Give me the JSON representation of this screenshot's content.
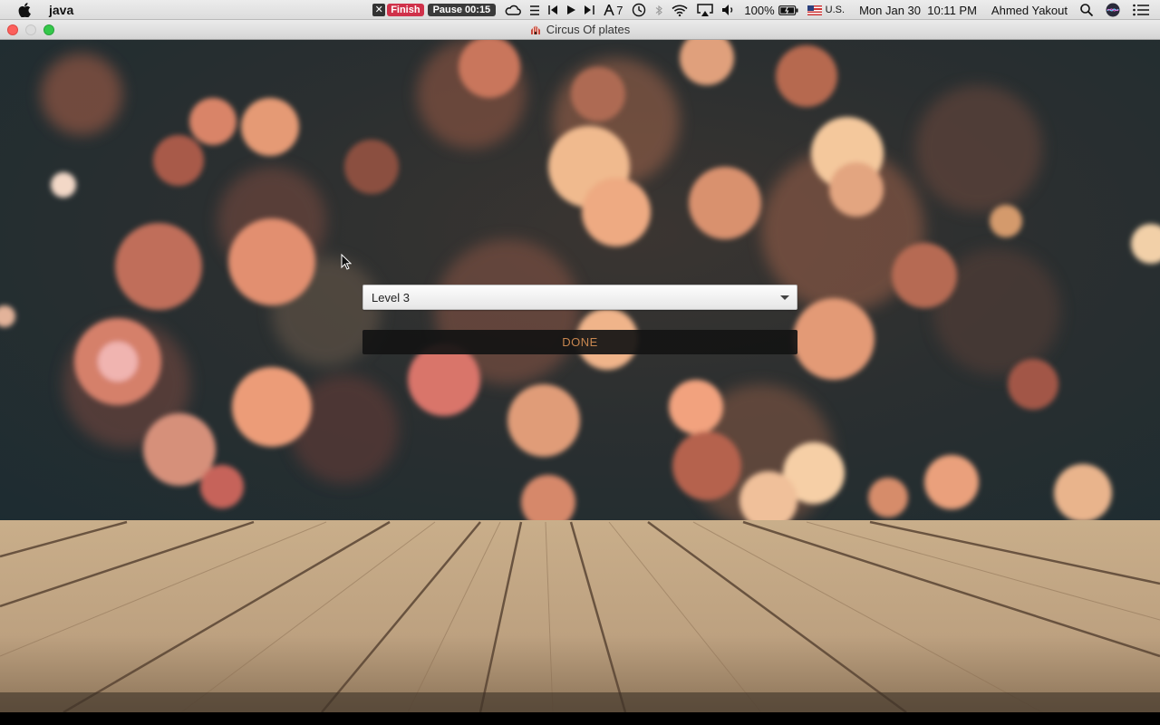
{
  "menubar": {
    "app_name": "java",
    "finish_label": "Finish",
    "pause_label": "Pause 00:15",
    "tab_count": "7",
    "battery": "100%",
    "input_source": "U.S.",
    "datetime": "Mon Jan 30  10:11 PM",
    "user": "Ahmed Yakout"
  },
  "window": {
    "title": "Circus Of plates"
  },
  "game": {
    "level_selected": "Level 3",
    "done_label": "DONE"
  },
  "colors": {
    "done_text": "#c7864f",
    "close": "#fc605c",
    "maximize": "#34c84a"
  },
  "icons": [
    "apple-icon",
    "cloud-icon",
    "list-icon",
    "prev-track-icon",
    "play-icon",
    "next-track-icon",
    "translate-icon",
    "time-machine-icon",
    "bluetooth-icon",
    "wifi-icon",
    "airplay-icon",
    "volume-icon",
    "battery-icon",
    "flag-icon",
    "spotlight-icon",
    "siri-icon",
    "notification-center-icon",
    "caret-down-icon",
    "mouse-cursor-icon"
  ]
}
